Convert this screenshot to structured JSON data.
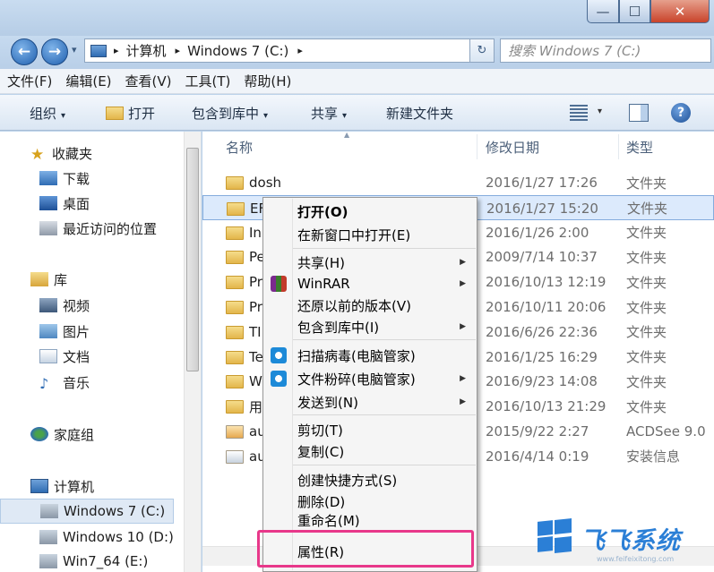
{
  "window": {
    "minimize_glyph": "—",
    "maximize_glyph": "☐",
    "close_glyph": "✕"
  },
  "address": {
    "back_glyph": "←",
    "forward_glyph": "→",
    "history_glyph": "▾",
    "crumb_sep": "▸",
    "crumbs": [
      "计算机",
      "Windows 7 (C:)"
    ],
    "refresh_glyph": "↻",
    "search_placeholder": "搜索 Windows 7 (C:)"
  },
  "menubar": [
    "文件(F)",
    "编辑(E)",
    "查看(V)",
    "工具(T)",
    "帮助(H)"
  ],
  "toolbar": {
    "organize": "组织",
    "open": "打开",
    "include": "包含到库中",
    "share": "共享",
    "new_folder": "新建文件夹",
    "caret": "▾",
    "help_glyph": "?"
  },
  "nav": {
    "favorites": "收藏夹",
    "downloads": "下载",
    "desktop": "桌面",
    "recent": "最近访问的位置",
    "libraries": "库",
    "videos": "视频",
    "pictures": "图片",
    "documents": "文档",
    "music": "音乐",
    "homegroup": "家庭组",
    "computer": "计算机",
    "drive_c": "Windows 7 (C:)",
    "drive_d": "Windows 10 (D:)",
    "drive_e": "Win7_64 (E:)"
  },
  "columns": {
    "name": "名称",
    "date": "修改日期",
    "type": "类型"
  },
  "rows": [
    {
      "name": "dosh",
      "date": "2016/1/27 17:26",
      "type": "文件夹"
    },
    {
      "name": "EF",
      "date": "2016/1/27 15:20",
      "type": "文件夹"
    },
    {
      "name": "In",
      "date": "2016/1/26 2:00",
      "type": "文件夹"
    },
    {
      "name": "Pe",
      "date": "2009/7/14 10:37",
      "type": "文件夹"
    },
    {
      "name": "Pr",
      "date": "2016/10/13 12:19",
      "type": "文件夹"
    },
    {
      "name": "Pr",
      "date": "2016/10/11 20:06",
      "type": "文件夹"
    },
    {
      "name": "TI",
      "date": "2016/6/26 22:36",
      "type": "文件夹"
    },
    {
      "name": "Te",
      "date": "2016/1/25 16:29",
      "type": "文件夹"
    },
    {
      "name": "W",
      "date": "2016/9/23 14:08",
      "type": "文件夹"
    },
    {
      "name": "用",
      "date": "2016/10/13 21:29",
      "type": "文件夹"
    },
    {
      "name": "au",
      "date": "2015/9/22 2:27",
      "type": "ACDSee 9.0"
    },
    {
      "name": "au",
      "date": "2016/4/14 0:19",
      "type": "安装信息"
    }
  ],
  "context_menu": {
    "open": "打开(O)",
    "open_new_window": "在新窗口中打开(E)",
    "share": "共享(H)",
    "winrar": "WinRAR",
    "restore": "还原以前的版本(V)",
    "include_library": "包含到库中(I)",
    "scan_virus": "扫描病毒(电脑管家)",
    "shred": "文件粉碎(电脑管家)",
    "send_to": "发送到(N)",
    "cut": "剪切(T)",
    "copy": "复制(C)",
    "create_shortcut": "创建快捷方式(S)",
    "delete": "删除(D)",
    "rename": "重命名(M)",
    "properties": "属性(R)",
    "submenu_glyph": "▶"
  },
  "watermark": {
    "brand": "飞飞系统",
    "url": "www.feifeixitong.com"
  }
}
